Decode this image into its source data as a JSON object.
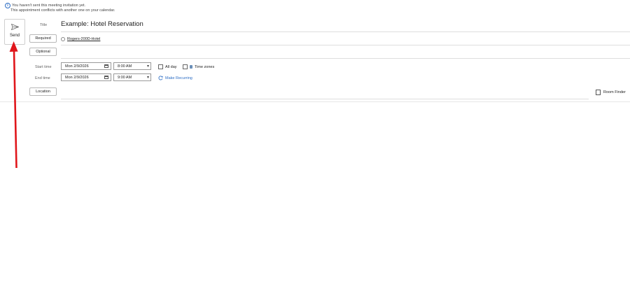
{
  "info": {
    "line1": "You haven't sent this meeting invitation yet.",
    "line2": "This appointment conflicts with another one on your calendar.",
    "icon": "info-icon"
  },
  "send": {
    "label": "Send",
    "icon": "send-icon"
  },
  "title": {
    "label": "Title",
    "value": "Example: Hotel Reservation"
  },
  "required": {
    "label": "Required",
    "attendee": "Rogers-200D-Hotel"
  },
  "optional": {
    "label": "Optional"
  },
  "start": {
    "label": "Start time",
    "date": "Mon 2/9/2026",
    "time": "8:00 AM"
  },
  "end": {
    "label": "End time",
    "date": "Mon 2/9/2026",
    "time": "9:00 AM"
  },
  "all_day": {
    "label": "All day"
  },
  "time_zones": {
    "label": "Time zones"
  },
  "recurring": {
    "label": "Make Recurring"
  },
  "location": {
    "label": "Location"
  },
  "room_finder": {
    "label": "Room Finder"
  },
  "colors": {
    "accent": "#2b6cc4",
    "annotation_arrow": "#e0161b"
  }
}
